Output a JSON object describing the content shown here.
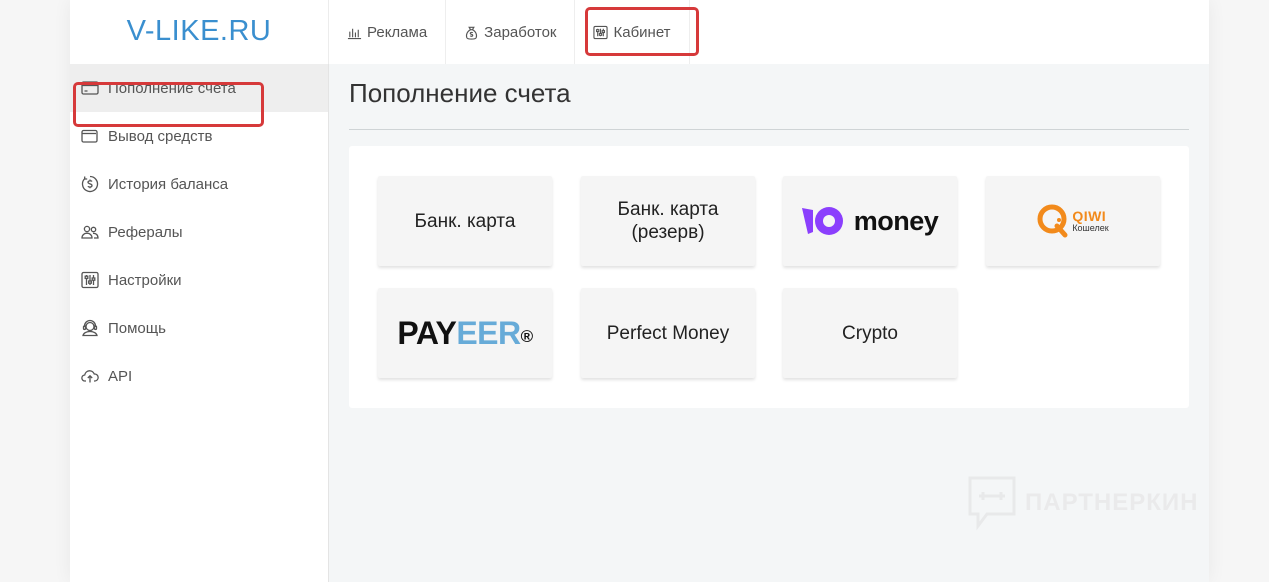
{
  "brand": {
    "name": "V-LIKE.RU"
  },
  "topnav": {
    "items": [
      {
        "label": "Реклама",
        "icon": "bar-chart-icon"
      },
      {
        "label": "Заработок",
        "icon": "money-bag-icon"
      },
      {
        "label": "Кабинет",
        "icon": "sliders-icon"
      }
    ]
  },
  "sidebar": {
    "items": [
      {
        "label": "Пополнение счета",
        "icon": "credit-card-icon",
        "active": true
      },
      {
        "label": "Вывод средств",
        "icon": "wallet-icon"
      },
      {
        "label": "История баланса",
        "icon": "dollar-circle-icon"
      },
      {
        "label": "Рефералы",
        "icon": "users-icon"
      },
      {
        "label": "Настройки",
        "icon": "settings-sliders-icon"
      },
      {
        "label": "Помощь",
        "icon": "support-icon"
      },
      {
        "label": "API",
        "icon": "cloud-upload-icon"
      }
    ]
  },
  "main": {
    "title": "Пополнение счета",
    "methods": [
      {
        "label": "Банк. карта"
      },
      {
        "label": "Банк. карта",
        "label2": "(резерв)"
      },
      {
        "logo": "yoomoney",
        "label": "money"
      },
      {
        "logo": "qiwi",
        "label": "QIWI",
        "sublabel": "Кошелек"
      },
      {
        "logo": "payeer",
        "label_a": "PAY",
        "label_b": "EER",
        "mark": "®"
      },
      {
        "label": "Perfect Money"
      },
      {
        "label": "Crypto"
      }
    ]
  },
  "watermark": {
    "text": "ПАРТНЕРКИН"
  },
  "colors": {
    "brand": "#3a8fcf",
    "highlight": "#d6393a",
    "yoomoney": "#8b3ffd",
    "qiwi": "#f28a1b",
    "payeer_blue": "#67abd8"
  }
}
